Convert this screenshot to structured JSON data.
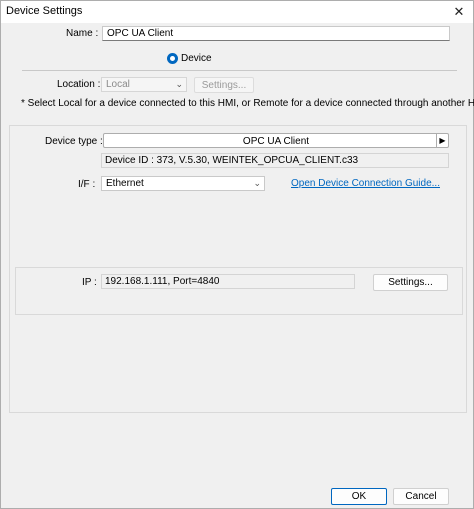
{
  "window": {
    "title": "Device Settings",
    "close_glyph": "✕"
  },
  "name": {
    "label": "Name :",
    "value": "OPC UA Client"
  },
  "location_type": {
    "selected_option": "Device"
  },
  "location": {
    "label": "Location :",
    "value": "Local",
    "settings_label": "Settings...",
    "note": "* Select Local for a device connected to this HMI, or Remote for a device connected through another HMI."
  },
  "device_type": {
    "label": "Device type :",
    "value": "OPC UA Client",
    "device_id": "Device ID : 373, V.5.30, WEINTEK_OPCUA_CLIENT.c33"
  },
  "interface": {
    "label": "I/F :",
    "value": "Ethernet",
    "guide_link": "Open Device Connection Guide..."
  },
  "ip": {
    "label": "IP :",
    "value": "192.168.1.111,  Port=4840",
    "settings_label": "Settings..."
  },
  "footer": {
    "ok_label": "OK",
    "cancel_label": "Cancel"
  },
  "colors": {
    "accent": "#0067c0",
    "window_bg": "#f0f0f0"
  },
  "icons": {
    "close": "close-icon",
    "dropdown": "chevron-down-icon",
    "arrow_right": "triangle-right-icon"
  }
}
